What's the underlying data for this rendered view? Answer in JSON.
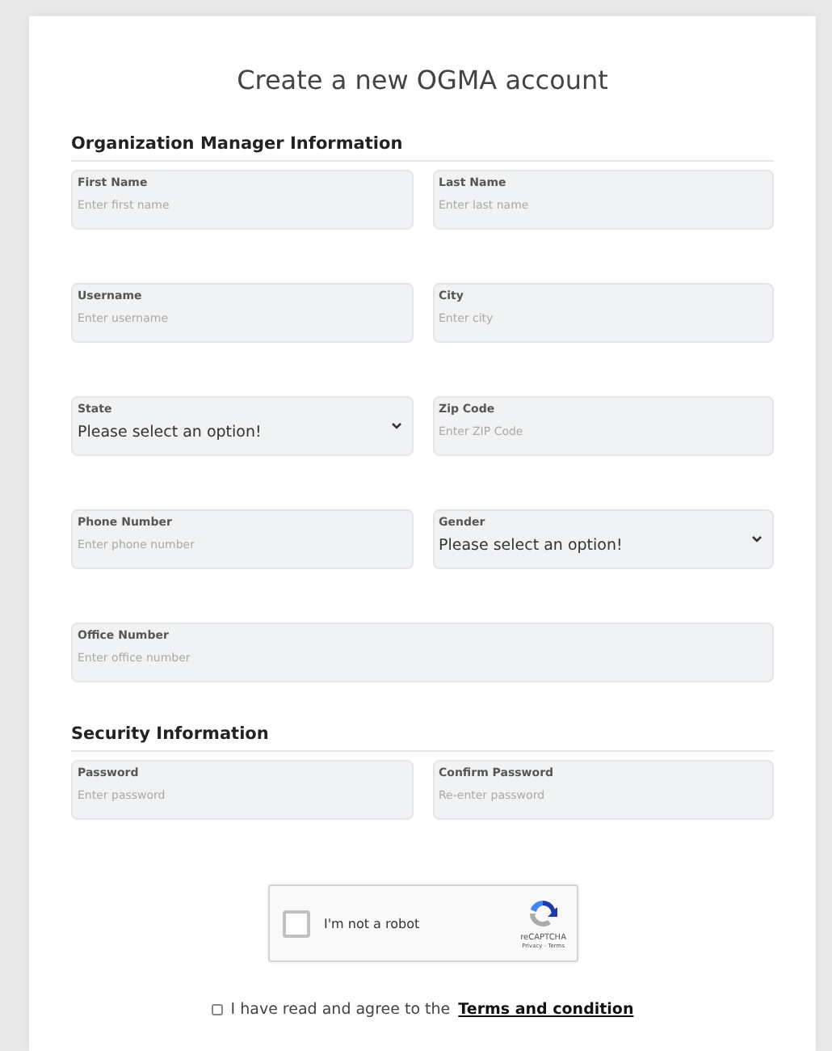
{
  "title": "Create a new OGMA account",
  "sections": [
    {
      "heading": "Organization Manager Information",
      "rows": [
        [
          {
            "kind": "input",
            "label": "First Name",
            "placeholder": "Enter first name"
          },
          {
            "kind": "input",
            "label": "Last Name",
            "placeholder": "Enter last name"
          }
        ],
        [
          {
            "kind": "input",
            "label": "Username",
            "placeholder": "Enter username"
          },
          {
            "kind": "input",
            "label": "City",
            "placeholder": "Enter city"
          }
        ],
        [
          {
            "kind": "select",
            "label": "State",
            "value": "Please select an option!"
          },
          {
            "kind": "input",
            "label": "Zip Code",
            "placeholder": "Enter ZIP Code"
          }
        ],
        [
          {
            "kind": "input",
            "label": "Phone Number",
            "placeholder": "Enter phone number"
          },
          {
            "kind": "select",
            "label": "Gender",
            "value": "Please select an option!"
          }
        ],
        [
          {
            "kind": "input",
            "label": "Office Number",
            "placeholder": "Enter office number"
          }
        ]
      ]
    },
    {
      "heading": "Security Information",
      "rows": [
        [
          {
            "kind": "input",
            "label": "Password",
            "placeholder": "Enter password"
          },
          {
            "kind": "input",
            "label": "Confirm Password",
            "placeholder": "Re-enter password"
          }
        ]
      ]
    }
  ],
  "captcha": {
    "checked": false,
    "label": "I'm not a robot",
    "brand": "reCAPTCHA",
    "links": "Privacy - Terms"
  },
  "agreement": {
    "checked": false,
    "text": "I have read and agree to the",
    "link": "Terms and condition"
  }
}
